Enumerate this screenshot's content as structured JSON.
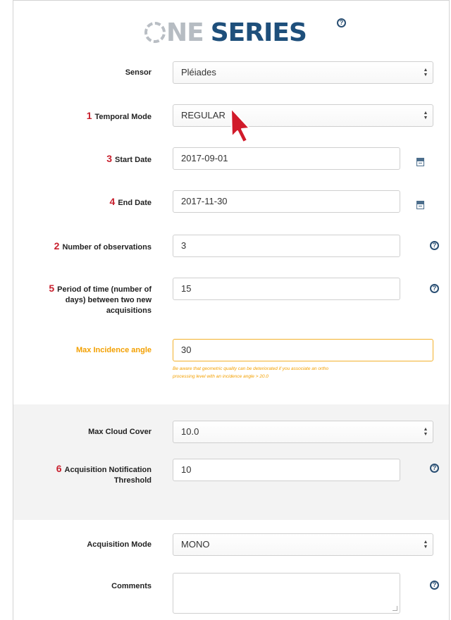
{
  "header": {
    "logo_ne": "NE",
    "logo_series": "SERIES"
  },
  "form": {
    "sensor": {
      "label": "Sensor",
      "value": "Pléiades"
    },
    "temporal_mode": {
      "num": "1",
      "label": "Temporal Mode",
      "value": "REGULAR"
    },
    "start_date": {
      "num": "3",
      "label": "Start Date",
      "value": "2017-09-01"
    },
    "end_date": {
      "num": "4",
      "label": "End Date",
      "value": "2017-11-30"
    },
    "observations": {
      "num": "2",
      "label": "Number of observations",
      "value": "3"
    },
    "period": {
      "num": "5",
      "label_line1": "Period of time (number of",
      "label_line2": "days) between two new",
      "label_line3": "acquisitions",
      "value": "15"
    },
    "max_incidence": {
      "label": "Max Incidence angle",
      "value": "30",
      "warning_line1": "Be aware that geometric quality can be deteriorated if you associate an ortho",
      "warning_line2": "processing level with an incidence angle > 20.0"
    },
    "max_cloud": {
      "label": "Max Cloud Cover",
      "value": "10.0"
    },
    "notification": {
      "num": "6",
      "label_line1": "Acquisition Notification",
      "label_line2": "Threshold",
      "value": "10"
    },
    "acq_mode": {
      "label": "Acquisition Mode",
      "value": "MONO"
    },
    "comments": {
      "label": "Comments",
      "value": ""
    }
  },
  "icons": {
    "help": "question-circle-icon",
    "calendar": "calendar-icon",
    "cursor": "mouse-pointer-icon"
  },
  "colors": {
    "brand": "#1e4f7b",
    "step_number": "#c8202e",
    "warning": "#f3a000",
    "band": "#f3f3f3"
  }
}
